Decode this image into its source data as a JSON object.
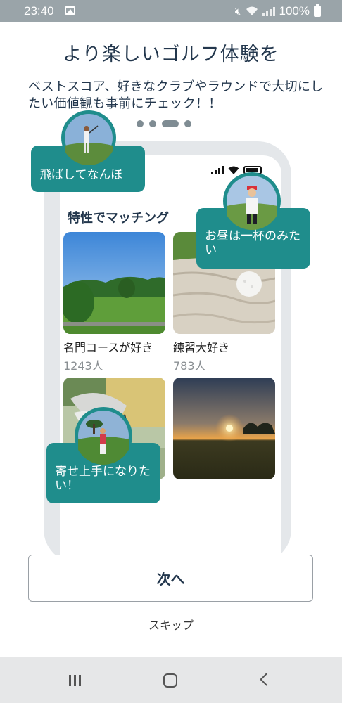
{
  "status_bar": {
    "time": "23:40",
    "battery": "100%"
  },
  "header": {
    "title": "より楽しいゴルフ体験を",
    "subtitle": "ベストスコア、好きなクラブやラウンドで大切にしたい価値観も事前にチェック！！"
  },
  "pager": {
    "count": 4,
    "active_index": 2
  },
  "phone": {
    "heading": "特性でマッチング",
    "cards": [
      {
        "name": "名門コースが好き",
        "count": "1243人"
      },
      {
        "name": "練習大好き",
        "count": "783人"
      },
      {
        "name": "",
        "count": ""
      },
      {
        "name": "",
        "count": ""
      }
    ]
  },
  "bubbles": [
    {
      "text": "飛ばしてなんぼ"
    },
    {
      "text": "お昼は一杯のみたい"
    },
    {
      "text": "寄せ上手になりたい！"
    }
  ],
  "actions": {
    "next_label": "次へ",
    "skip_label": "スキップ"
  },
  "colors": {
    "accent": "#1f8d8c",
    "text": "#23374d"
  }
}
